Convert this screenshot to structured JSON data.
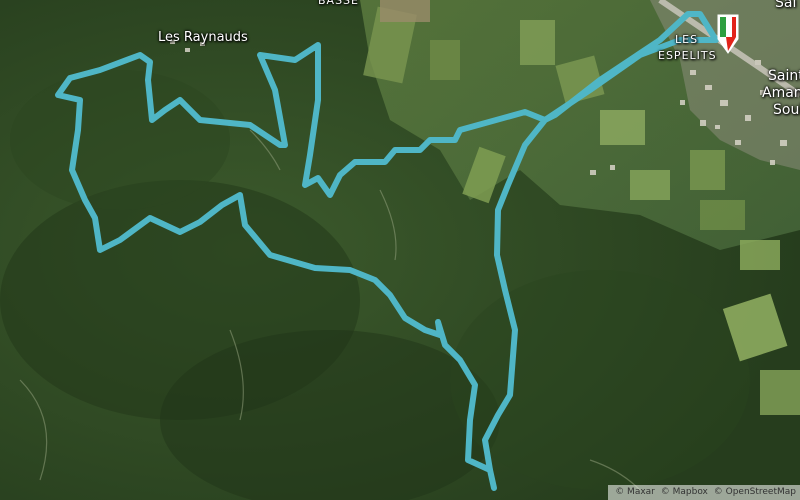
{
  "map": {
    "place_labels": [
      {
        "id": "les-raynauds",
        "text": "Les Raynauds"
      },
      {
        "id": "basse",
        "text": "BASSE"
      },
      {
        "id": "les",
        "text": "LES"
      },
      {
        "id": "espelits",
        "text": "ESPELITS"
      },
      {
        "id": "saint",
        "text": "Saint"
      },
      {
        "id": "aman",
        "text": "Aman"
      },
      {
        "id": "soul",
        "text": "Soul"
      },
      {
        "id": "sai",
        "text": "Sai"
      }
    ],
    "route": {
      "color": "#4fb6c6",
      "type": "loop"
    },
    "start_marker": {
      "icon": "flag-start-icon",
      "colors": [
        "#2e9e3f",
        "#ffffff",
        "#e2231a"
      ]
    },
    "attribution": [
      "© Maxar",
      "© Mapbox",
      "© OpenStreetMap"
    ]
  }
}
